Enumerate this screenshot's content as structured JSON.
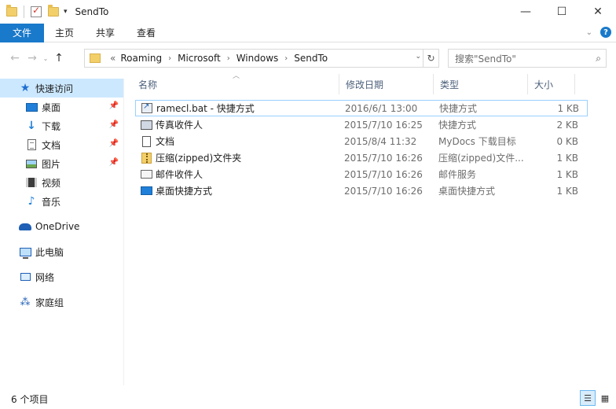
{
  "window": {
    "title": "SendTo",
    "controls": {
      "minimize": "—",
      "maximize": "☐",
      "close": "✕"
    }
  },
  "ribbon": {
    "file": "文件",
    "tabs": [
      "主页",
      "共享",
      "查看"
    ],
    "expand": "⌄",
    "help": "?"
  },
  "nav": {
    "back": "←",
    "forward": "→",
    "recent": "⌄",
    "up": "↑",
    "breadcrumb_prefix": "«",
    "breadcrumbs": [
      "Roaming",
      "Microsoft",
      "Windows",
      "SendTo"
    ],
    "refresh": "↻",
    "search_placeholder": "搜索\"SendTo\""
  },
  "sidebar": {
    "quick_access": "快速访问",
    "items": [
      {
        "label": "桌面",
        "icon": "desktop-icon",
        "pinned": true
      },
      {
        "label": "下载",
        "icon": "download-icon",
        "pinned": true
      },
      {
        "label": "文档",
        "icon": "document-icon",
        "pinned": true
      },
      {
        "label": "图片",
        "icon": "picture-icon",
        "pinned": true
      },
      {
        "label": "视频",
        "icon": "video-icon",
        "pinned": false
      },
      {
        "label": "音乐",
        "icon": "music-icon",
        "pinned": false
      }
    ],
    "onedrive": "OneDrive",
    "this_pc": "此电脑",
    "network": "网络",
    "homegroup": "家庭组"
  },
  "columns": {
    "name": "名称",
    "date": "修改日期",
    "type": "类型",
    "size": "大小"
  },
  "files": [
    {
      "name": "ramecl.bat - 快捷方式",
      "date": "2016/6/1 13:00",
      "type": "快捷方式",
      "size": "1 KB",
      "icon": "shortcut-icon"
    },
    {
      "name": "传真收件人",
      "date": "2015/7/10 16:25",
      "type": "快捷方式",
      "size": "2 KB",
      "icon": "fax-icon"
    },
    {
      "name": "文档",
      "date": "2015/8/4 11:32",
      "type": "MyDocs 下载目标",
      "size": "0 KB",
      "icon": "document-icon"
    },
    {
      "name": "压缩(zipped)文件夹",
      "date": "2015/7/10 16:26",
      "type": "压缩(zipped)文件...",
      "size": "1 KB",
      "icon": "zip-folder-icon"
    },
    {
      "name": "邮件收件人",
      "date": "2015/7/10 16:26",
      "type": "邮件服务",
      "size": "1 KB",
      "icon": "mail-icon"
    },
    {
      "name": "桌面快捷方式",
      "date": "2015/7/10 16:26",
      "type": "桌面快捷方式",
      "size": "1 KB",
      "icon": "desktop-icon"
    }
  ],
  "status": {
    "count": "6 个项目"
  }
}
